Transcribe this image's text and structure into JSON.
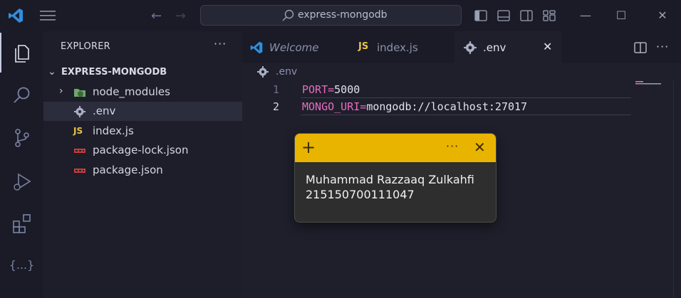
{
  "titlebar": {
    "search_text": "express-mongodb",
    "icons": [
      "vscode-logo",
      "menu-icon",
      "back-arrow-icon",
      "forward-arrow-icon",
      "search-icon",
      "toggle-primary-sidebar-icon",
      "toggle-panel-icon",
      "toggle-secondary-sidebar-icon",
      "customize-layout-icon",
      "minimize-icon",
      "maximize-icon",
      "close-icon"
    ],
    "minimize": "—",
    "maximize": "☐",
    "close": "✕"
  },
  "activitybar": {
    "items": [
      "explorer",
      "search",
      "source-control",
      "run-and-debug",
      "extensions",
      "json"
    ],
    "json_label": "{...}"
  },
  "sidebar": {
    "header": "EXPLORER",
    "more": "···",
    "folder": "EXPRESS-MONGODB",
    "items": [
      {
        "label": "node_modules",
        "icon": "node-folder-icon"
      },
      {
        "label": ".env",
        "icon": "gear-icon"
      },
      {
        "label": "index.js",
        "icon": "js-icon"
      },
      {
        "label": "package-lock.json",
        "icon": "npm-icon"
      },
      {
        "label": "package.json",
        "icon": "npm-icon"
      }
    ],
    "js_glyph": "JS"
  },
  "tabs": [
    {
      "label": "Welcome",
      "icon": "vscode-icon"
    },
    {
      "label": "index.js",
      "icon": "js-icon"
    },
    {
      "label": ".env",
      "icon": "gear-icon",
      "active": true
    }
  ],
  "tab_close": "✕",
  "editor_actions_more": "···",
  "breadcrumb": ".env",
  "code": {
    "lines": [
      {
        "num": "1",
        "key": "PORT",
        "eq": "=",
        "value": "5000"
      },
      {
        "num": "2",
        "key": "MONGO_URI",
        "eq": "=",
        "value": "mongodb://localhost:27017"
      }
    ]
  },
  "note": {
    "plus": "+",
    "more": "···",
    "close": "✕",
    "line1": "Muhammad Razzaaq Zulkahfi",
    "line2": "215150700111047"
  },
  "colors": {
    "key": "#e86cbf",
    "accent_note": "#e9b400",
    "js": "#e8c547",
    "npm": "#c43d3d"
  }
}
